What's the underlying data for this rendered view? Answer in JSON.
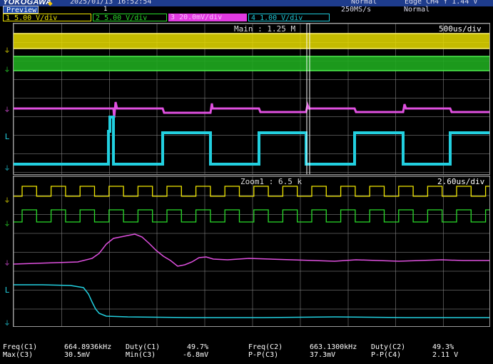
{
  "header": {
    "brand": "YOKOGAWA",
    "timestamp": "2025/01/13  16:52:54",
    "trigger_mode": "Normal",
    "trigger_source": "Edge CH4",
    "mode_button": "Preview",
    "sample_rate": "250MS/s",
    "trigger_level_label": "Normal",
    "trigger_level_value": "1.44 V",
    "trigger_position_mark": "1"
  },
  "channels": [
    {
      "id": "1",
      "scale": "5.00 V/div",
      "color": "#f0e600"
    },
    {
      "id": "2",
      "scale": "5.00 V/div",
      "color": "#2adc2a"
    },
    {
      "id": "3",
      "scale": "20.0mV/div",
      "color": "#e23ae2"
    },
    {
      "id": "4",
      "scale": "1.00 V/div",
      "color": "#1ec8d8"
    }
  ],
  "main_window": {
    "label": "Main : 1.25 M",
    "time_div": "500us/div"
  },
  "zoom_window": {
    "label": "Zoom1 : 6.5 k",
    "time_div": "2.60us/div"
  },
  "measurements": [
    {
      "label": "Freq(C1)",
      "value": "664.8936kHz"
    },
    {
      "label": "Duty(C1)",
      "value": "49.7%"
    },
    {
      "label": "Freq(C2)",
      "value": "663.1300kHz"
    },
    {
      "label": "Duty(C2)",
      "value": "49.3%"
    },
    {
      "label": "Max(C3)",
      "value": "30.5mV"
    },
    {
      "label": "Min(C3)",
      "value": "-6.8mV"
    },
    {
      "label": "P-P(C3)",
      "value": "37.3mV"
    },
    {
      "label": "P-P(C4)",
      "value": "2.11 V"
    }
  ]
}
